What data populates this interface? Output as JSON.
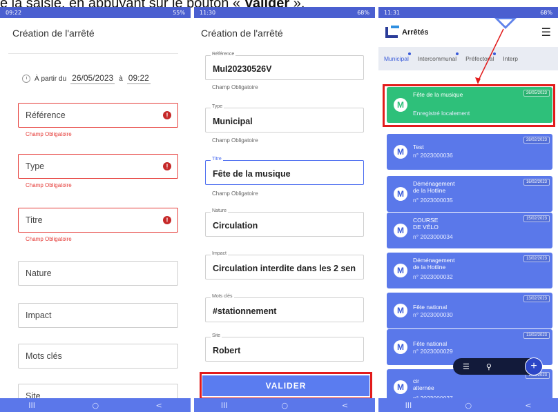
{
  "caption": {
    "prefix": "e la saisie, en appuyant sur le bouton « ",
    "bold": "Valider",
    "suffix": " »."
  },
  "phones": {
    "p1": {
      "status_time": "09:22",
      "status_right": "55%",
      "title": "Création de l'arrêté",
      "date_label_before": "À partir du",
      "date_value": "26/05/2023",
      "date_label_mid": "à",
      "time_value": "09:22",
      "fields": {
        "reference": "Référence",
        "type": "Type",
        "titre": "Titre",
        "nature": "Nature",
        "impact": "Impact",
        "mots_cles": "Mots clés",
        "site": "Site"
      },
      "error_text": "Champ Obligatoire",
      "error_icon": "!"
    },
    "p2": {
      "status_time": "11:30",
      "status_right": "68%",
      "title": "Création de l'arrêté",
      "fields": [
        {
          "legend": "Référence",
          "value": "MuI20230526V"
        },
        {
          "legend": "Type",
          "value": "Municipal"
        },
        {
          "legend": "Titre",
          "value": "Fête  de la musique"
        },
        {
          "legend": "Nature",
          "value": "Circulation"
        },
        {
          "legend": "Impact",
          "value": "Circulation interdite dans les 2 sen"
        },
        {
          "legend": "Mots clés",
          "value": "#stationnement"
        },
        {
          "legend": "Site",
          "value": "Robert"
        }
      ],
      "hint": "Champ Obligatoire",
      "validate_label": "VALIDER"
    },
    "p3": {
      "status_time": "11:31",
      "status_right": "68%",
      "app_title": "Arrêtés",
      "tabs": [
        "Municipal",
        "Intercommunal",
        "Préfectoral",
        "Interp"
      ],
      "cards": [
        {
          "title": "Fête de la musique",
          "sub": "Enregistré localement",
          "date": "26/05/2023",
          "avatar": "M"
        },
        {
          "title": "Test",
          "sub": "n° 2023000036",
          "date": "28/02/2023",
          "avatar": "M"
        },
        {
          "title": "Déménagement de la Hotline",
          "sub": "n° 2023000035",
          "date": "16/02/2023",
          "avatar": "M"
        },
        {
          "title": "COURSE DE VÉLO",
          "sub": "n° 2023000034",
          "date": "15/02/2023",
          "avatar": "M"
        },
        {
          "title": "Déménagement de la Hotline",
          "sub": "n° 2023000032",
          "date": "13/02/2023",
          "avatar": "M"
        },
        {
          "title": "Fête national",
          "sub": "n° 2023000030",
          "date": "13/02/2023",
          "avatar": "M"
        },
        {
          "title": "Fête national",
          "sub": "n° 2023000029",
          "date": "13/02/2023",
          "avatar": "M"
        },
        {
          "title": "cir alternée",
          "sub": "n° 2023000027",
          "date": "7/02/2023",
          "avatar": "M"
        }
      ],
      "fab_plus": "+"
    },
    "nav": {
      "recent": "III",
      "home": "○",
      "back": "<"
    }
  },
  "colors": {
    "primary_blue": "#5a78ea",
    "status_blue": "#4a5fd0",
    "green": "#2ec07a",
    "error_red": "#e53935",
    "highlight_red": "#e21b1b"
  }
}
